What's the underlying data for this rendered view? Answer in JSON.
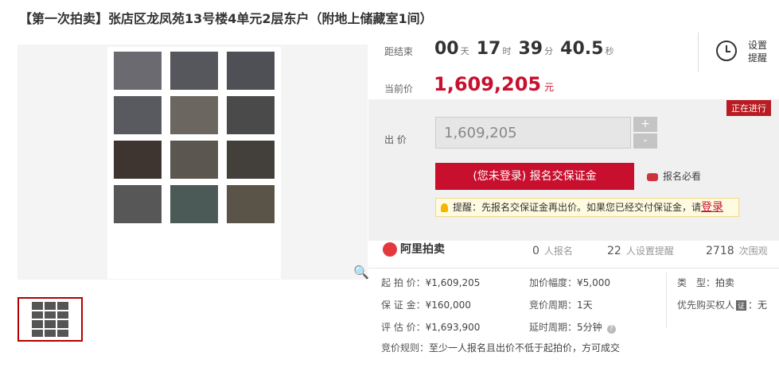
{
  "title": "【第一次拍卖】张店区龙凤苑13号楼4单元2层东户（附地上储藏室1间）",
  "countdown": {
    "label": "距结束",
    "days": "00",
    "days_unit": "天",
    "hours": "17",
    "hours_unit": "时",
    "minutes": "39",
    "minutes_unit": "分",
    "seconds": "40.5",
    "seconds_unit": "秒"
  },
  "reminder": {
    "label": "设置提醒",
    "icon": "alarm-clock-icon"
  },
  "current_price": {
    "label": "当前价",
    "value": "1,609,205",
    "unit": "元"
  },
  "status_badge": "正在进行",
  "bid": {
    "label": "出 价",
    "input_value": "1,609,205",
    "plus": "+",
    "minus": "-",
    "signup_button": "(您未登录) 报名交保证金",
    "must_read": "报名必看"
  },
  "tip": {
    "text": "提醒：先报名交保证金再出价。如果您已经交付保证金，请",
    "login_link": "登录"
  },
  "platform": {
    "name": "阿里拍卖",
    "icon": "ali-auction-logo"
  },
  "stats": [
    {
      "num": "0",
      "label": "人报名"
    },
    {
      "num": "22",
      "label": "人设置提醒"
    },
    {
      "num": "2718",
      "label": "次围观"
    }
  ],
  "details": {
    "start_price": {
      "k": "起 拍 价：",
      "v": "¥1,609,205"
    },
    "deposit": {
      "k": "保 证 金：",
      "v": "¥160,000"
    },
    "appraisal": {
      "k": "评 估 价：",
      "v": "¥1,693,900"
    },
    "increment": {
      "k": "加价幅度：",
      "v": "¥5,000"
    },
    "period": {
      "k": "竞价周期：",
      "v": "1天"
    },
    "delay": {
      "k": "延时周期：",
      "v": "5分钟"
    },
    "type": {
      "k": "类　型：",
      "v": "拍卖"
    },
    "priority": {
      "k": "优先购买权人",
      "badge": "证",
      "v": "：无"
    },
    "rule": {
      "k": "竞价规则：",
      "v": "至少一人报名且出价不低于起拍价，方可成交"
    }
  }
}
